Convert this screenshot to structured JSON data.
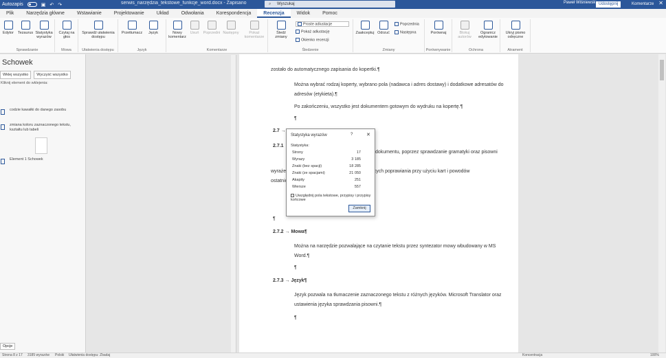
{
  "titlebar": {
    "autosave_label": "Autozapis",
    "doc_title": "serwis_narzędzia_tekstowe_funkcje_word.docx - Zapisano",
    "search_placeholder": "Wyszukaj",
    "user_name": "Paweł Wiśniewski",
    "win_minimize": "–",
    "win_maximize": "□",
    "win_close": "✕"
  },
  "tabs": [
    "Plik",
    "Narzędzia główne",
    "Wstawianie",
    "Projektowanie",
    "Układ",
    "Odwołania",
    "Korespondencja",
    "Recenzja",
    "Widok",
    "Pomoc"
  ],
  "active_tab": "Recenzja",
  "share_label": "Udostępnij",
  "comments_label": "Komentarze",
  "ribbon": {
    "groups": [
      {
        "label": "Sprawdzanie",
        "buttons": [
          "Edytor",
          "Tezaurus",
          "Statystyka wyrazów"
        ]
      },
      {
        "label": "Mowa",
        "buttons": [
          "Czytaj na głos"
        ]
      },
      {
        "label": "Ułatwienia dostępu",
        "buttons": [
          "Sprawdź ułatwienia dostępu"
        ]
      },
      {
        "label": "Język",
        "buttons": [
          "Przetłumacz",
          "Język"
        ]
      },
      {
        "label": "Komentarze",
        "buttons": [
          "Nowy komentarz",
          "Usuń",
          "Poprzedni",
          "Następny",
          "Pokaż komentarze"
        ]
      },
      {
        "label": "Śledzenie",
        "buttons": [
          "Śledź zmiany"
        ],
        "small": [
          "Proste adiustacje",
          "Pokaż adiustację",
          "Okienko recenzji"
        ]
      },
      {
        "label": "Zmiany",
        "buttons": [
          "Zaakceptuj",
          "Odrzuć"
        ],
        "small": [
          "Poprzednia",
          "Następna"
        ]
      },
      {
        "label": "Porównywanie",
        "buttons": [
          "Porównaj"
        ]
      },
      {
        "label": "Ochrona",
        "buttons": [
          "Blokuj autorów",
          "Ogranicz edytowanie"
        ]
      },
      {
        "label": "Atrament",
        "buttons": [
          "Ukryj pismo odręczne"
        ]
      }
    ]
  },
  "clipboard": {
    "title": "Schowek",
    "paste_all": "Wklej wszystko",
    "clear_all": "Wyczyść wszystko",
    "hint": "Kliknij element do wklejenia:",
    "items": [
      "codzie kawałki do danego zasobu",
      "zmiana koloru zaznaczonego tekstu, kształtu lub tabeli",
      "Element 1 Schowek"
    ],
    "options": "Opcje"
  },
  "document": {
    "line1": "zostało do automatycznego zapisania do kopertki.¶",
    "para1": "Można wybrać rodzaj koperty, wybrano pola (nadawca i adres dostawy) i dodatkowe adresatów do adresów (etykieta).¶",
    "para2": "Po zakończeniu, wszystko jest dokumentem gotowym do wydruku na kopertę.¶",
    "pmark": "¶",
    "h_27": "2.7 → ",
    "h_271": "2.7.1",
    "para3a": "dokumentu, poprzez sprawdzanie gramatyki oraz pisowni",
    "para3b": "wyrażeń, a następnie pomaga w decyzji dotyczących poprawiania przy użyciu kart i powodów",
    "para3c": "ostatnio zmienionych.",
    "h_272": "2.7.2 → Mowa¶",
    "para4": "Można na narzędzie pozwalające na czytanie tekstu przez syntezator mowy wbudowany w MS Word.¶",
    "h_273": "2.7.3 → Język¶",
    "para5": "Język pozwala na tłumaczenie zaznaczonego tekstu z różnych języków. Microsoft Translator oraz ustawienia języka sprawdzania pisowni.¶"
  },
  "dialog": {
    "title": "Statystyka wyrazów",
    "help": "?",
    "close": "✕",
    "section": "Statystyka:",
    "stats": [
      {
        "label": "Strony",
        "value": "17"
      },
      {
        "label": "Wyrazy",
        "value": "3 185"
      },
      {
        "label": "Znaki (bez spacji)",
        "value": "18 285"
      },
      {
        "label": "Znaki (ze spacjami)",
        "value": "21 050"
      },
      {
        "label": "Akapity",
        "value": "251"
      },
      {
        "label": "Wiersze",
        "value": "557"
      }
    ],
    "checkbox_label": "Uwzględnij pola tekstowe, przypisy i przypisy końcowe",
    "close_button": "Zamknij"
  },
  "statusbar": {
    "page": "Strona 8 z 17",
    "words": "3185 wyrazów",
    "lang": "Polski",
    "accessibility": "Ułatwienia dostępu: Zbadaj",
    "focus": "Koncentracja",
    "zoom": "100%"
  }
}
